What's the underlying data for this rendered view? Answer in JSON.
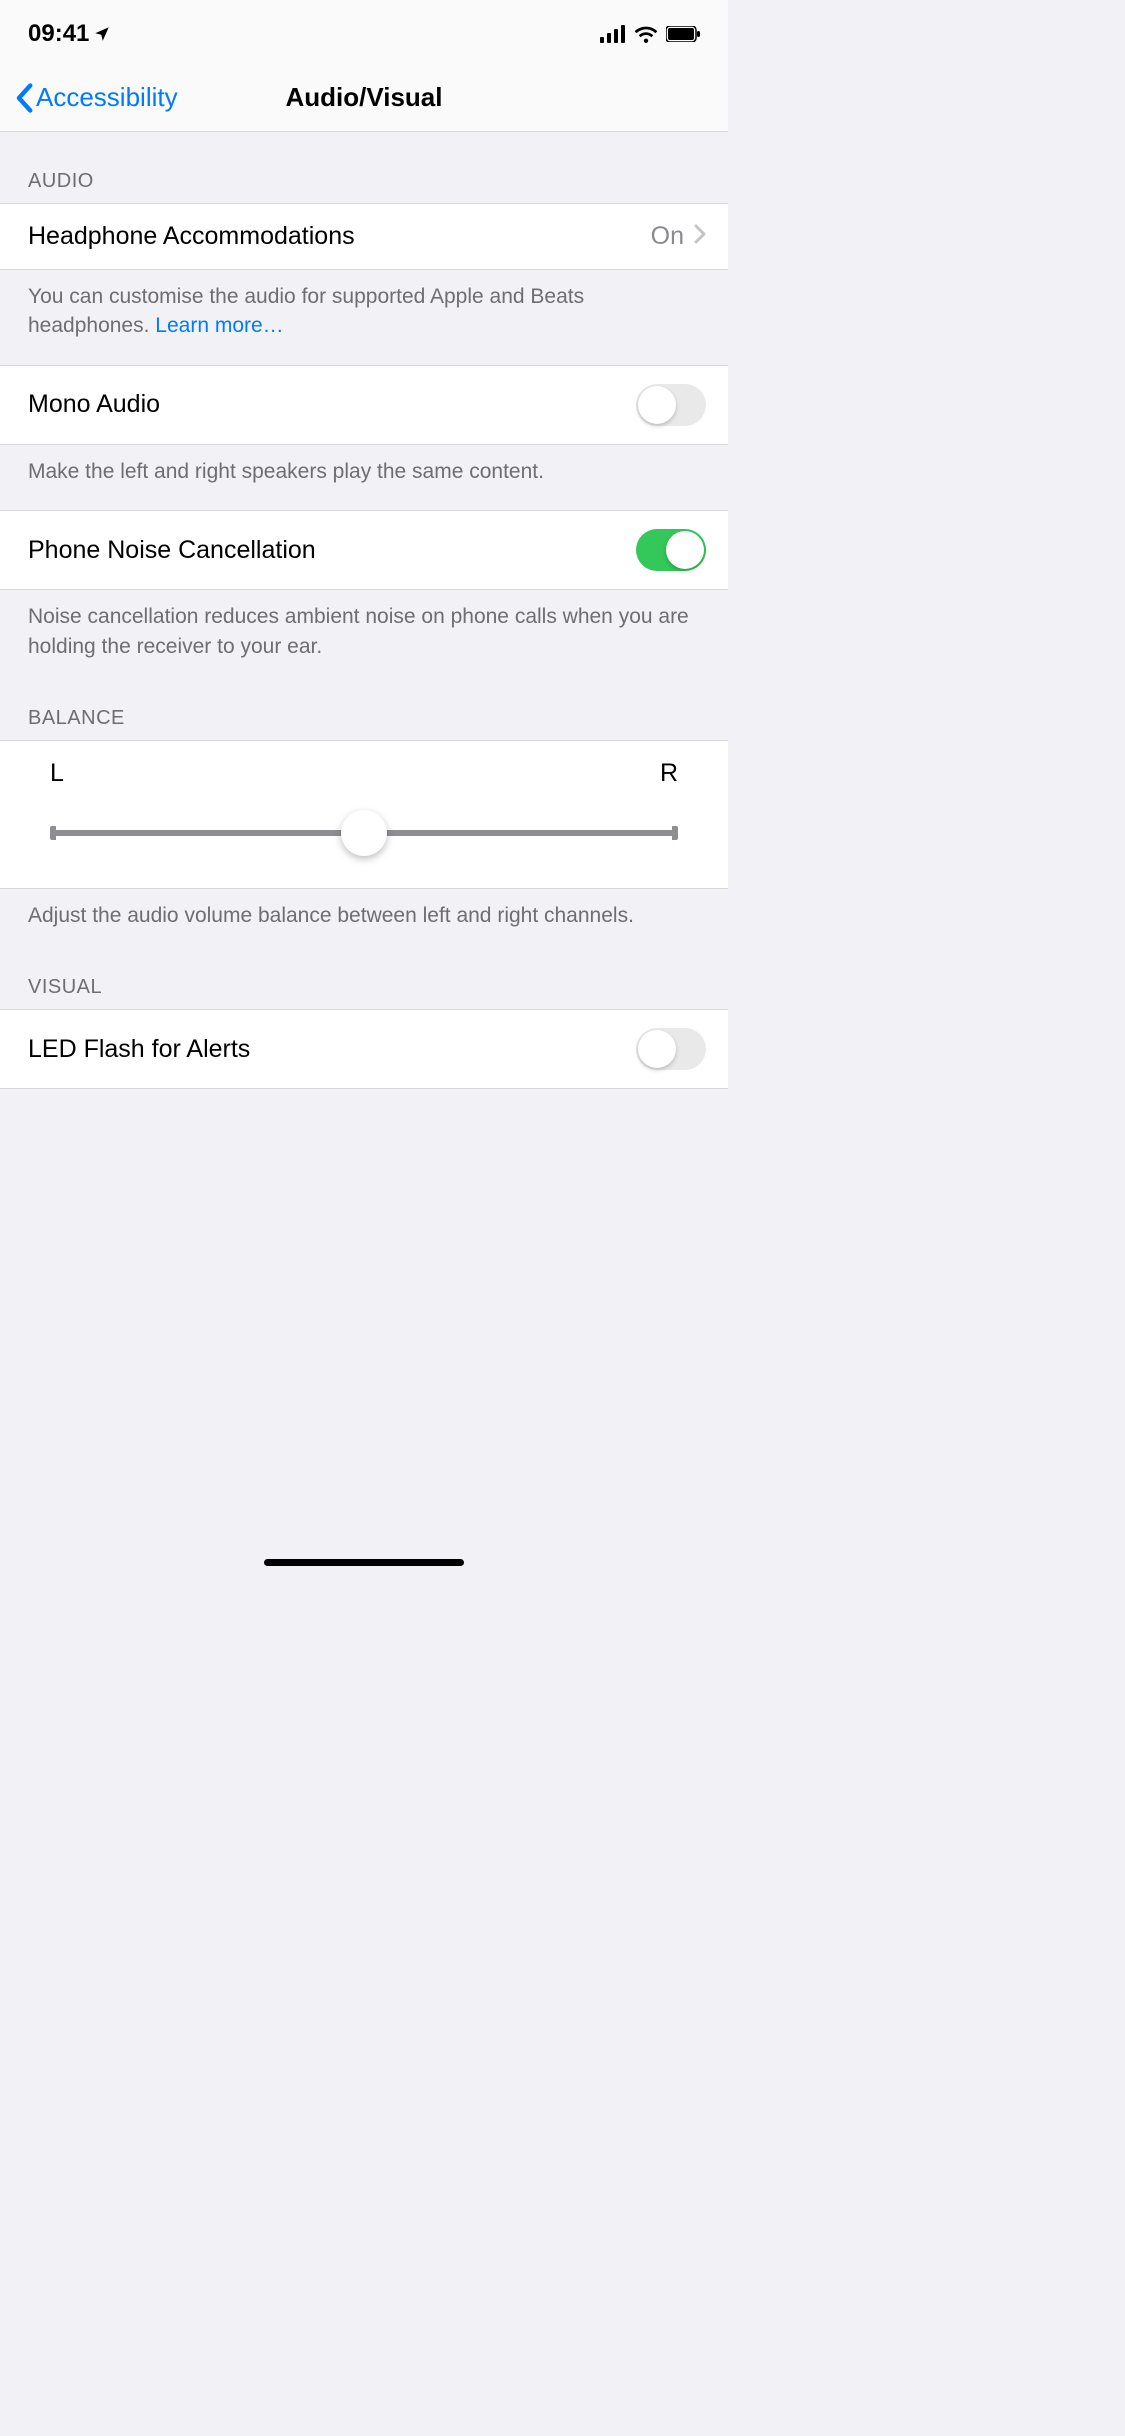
{
  "status": {
    "time": "09:41"
  },
  "nav": {
    "back": "Accessibility",
    "title": "Audio/Visual"
  },
  "sections": {
    "audio_header": "AUDIO",
    "headphone": {
      "label": "Headphone Accommodations",
      "value": "On"
    },
    "headphone_footer": "You can customise the audio for supported Apple and Beats headphones. ",
    "headphone_learn": "Learn more…",
    "mono": {
      "label": "Mono Audio",
      "on": false
    },
    "mono_footer": "Make the left and right speakers play the same content.",
    "noise": {
      "label": "Phone Noise Cancellation",
      "on": true
    },
    "noise_footer": "Noise cancellation reduces ambient noise on phone calls when you are holding the receiver to your ear.",
    "balance_header": "BALANCE",
    "balance": {
      "left": "L",
      "right": "R",
      "value": 0.5
    },
    "balance_footer": "Adjust the audio volume balance between left and right channels.",
    "visual_header": "VISUAL",
    "led": {
      "label": "LED Flash for Alerts",
      "on": false
    }
  }
}
